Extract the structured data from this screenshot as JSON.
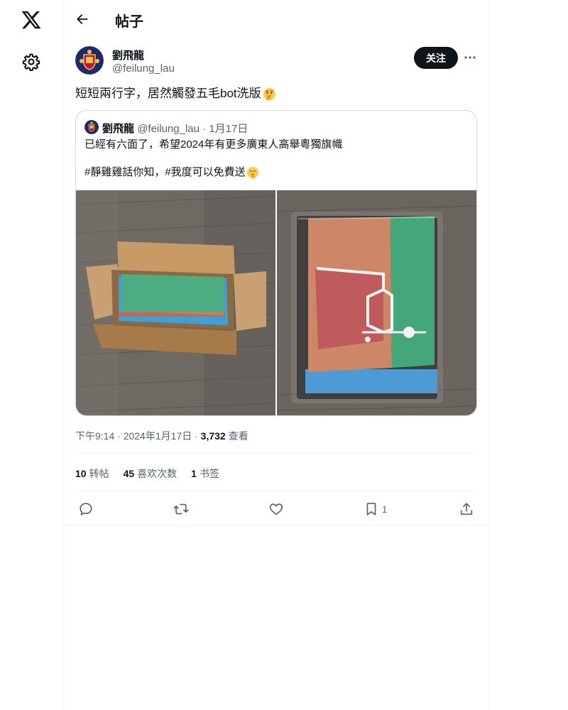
{
  "header": {
    "title": "帖子"
  },
  "author": {
    "display_name": "劉飛龍",
    "handle": "@feilung_lau"
  },
  "follow_label": "关注",
  "tweet": {
    "text": "短短兩行字，居然觸發五毛bot洗版"
  },
  "quoted": {
    "display_name": "劉飛龍",
    "handle": "@feilung_lau",
    "separator": "·",
    "date": "1月17日",
    "text_line1": "已經有六面了，希望2024年有更多廣東人高舉粵獨旗幟",
    "text_line2": "#靜雞雞話你知，#我度可以免費送"
  },
  "meta": {
    "time": "下午9:14",
    "sep1": "·",
    "date": "2024年1月17日",
    "sep2": "·",
    "views": "3,732",
    "views_label": "查看"
  },
  "stats": [
    {
      "count": "10",
      "label": "转帖"
    },
    {
      "count": "45",
      "label": "喜欢次数"
    },
    {
      "count": "1",
      "label": "书签"
    }
  ],
  "actions": {
    "bookmark_count": "1"
  },
  "icons": {
    "logo": "x-logo-icon",
    "settings": "gear-icon",
    "back": "back-arrow-icon",
    "more": "more-dots-icon",
    "reply": "reply-icon",
    "repost": "repost-icon",
    "like": "heart-icon",
    "bookmark": "bookmark-icon",
    "share": "share-icon"
  },
  "colors": {
    "text_primary": "#0f1419",
    "text_secondary": "#536471",
    "border": "#cfd9de",
    "follow_bg": "#0f1419"
  }
}
